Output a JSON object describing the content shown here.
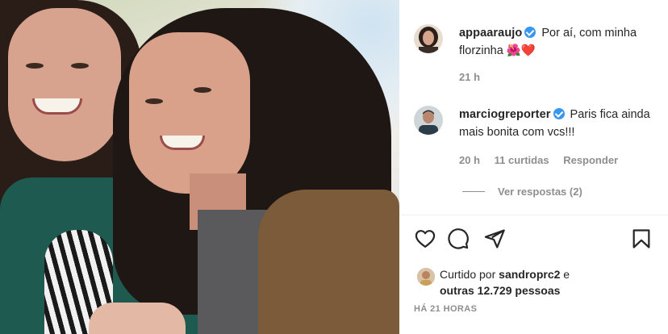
{
  "comments": [
    {
      "username": "appaaraujo",
      "text": "Por aí, com minha florzinha",
      "emoji": "🌺❤️",
      "age": "21 h"
    },
    {
      "username": "marciogreporter",
      "text": "Paris fica ainda mais bonita com vcs!!!",
      "age": "20 h",
      "likes": "11 curtidas",
      "reply_label": "Responder"
    }
  ],
  "view_replies": "Ver respostas (2)",
  "liked_by": {
    "prefix": "Curtido por",
    "user": "sandroprc2",
    "conjunction": "e",
    "others": "outras 12.729 pessoas"
  },
  "timestamp": "HÁ 21 HORAS",
  "icons": {
    "like": "heart-icon",
    "comment": "comment-icon",
    "share": "paper-plane-icon",
    "save": "bookmark-icon"
  },
  "colors": {
    "verified": "#3897f0",
    "muted_text": "#8e8e8e",
    "primary_text": "#262626"
  }
}
